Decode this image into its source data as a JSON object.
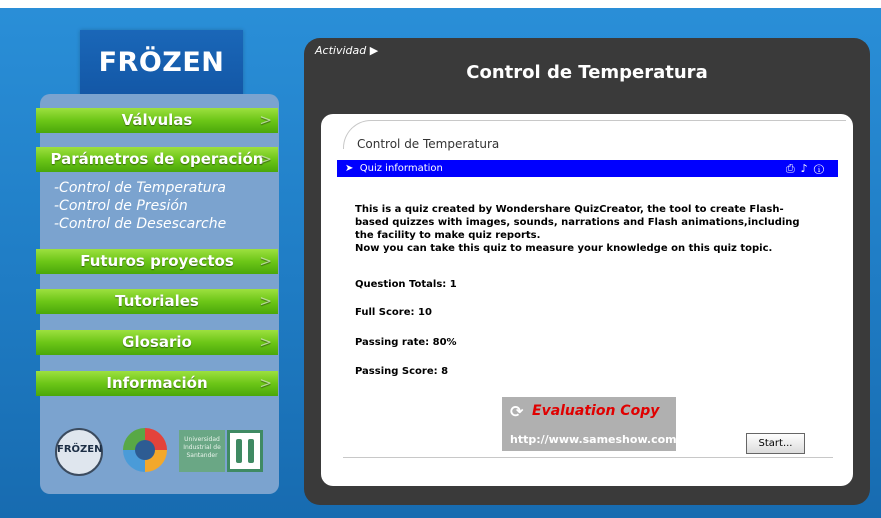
{
  "logo": {
    "text": "FRÖZEN"
  },
  "menu": {
    "items": [
      {
        "label": "Válvulas"
      },
      {
        "label": "Parámetros de operación"
      },
      {
        "label": "Futuros proyectos"
      },
      {
        "label": "Tutoriales"
      },
      {
        "label": "Glosario"
      },
      {
        "label": "Información"
      }
    ],
    "submenu": [
      {
        "label": "-Control de Temperatura"
      },
      {
        "label": "-Control de Presión"
      },
      {
        "label": "-Control de Desescarche"
      }
    ]
  },
  "header": {
    "activity": "Actividad ▶",
    "title": "Control de Temperatura"
  },
  "quiz": {
    "panel_title": "Control de Temperatura",
    "bar_label": "Quiz information",
    "bar_icons": [
      "print-icon",
      "speaker-icon",
      "info-icon"
    ],
    "intro": "This is a quiz created by Wondershare QuizCreator, the tool to create Flash-based quizzes with images, sounds, narrations and Flash animations,including the facility to make quiz reports.",
    "intro2": "Now you can take this quiz to measure your knowledge on this quiz topic.",
    "question_totals": "Question Totals: 1",
    "full_score": "Full Score: 10",
    "passing_rate": "Passing rate: 80%",
    "passing_score": "Passing Score: 8",
    "start_label": "Start..."
  },
  "evaluation": {
    "title": "Evaluation Copy",
    "url": "http://www.sameshow.com"
  },
  "footer_badges": {
    "frozen_badge": "FRÖZEN",
    "university": "Universidad Industrial de Santander"
  },
  "colors": {
    "bar_blue": "#0000ff",
    "menu_green": "#6cc617",
    "panel_dark": "#3a3a3a"
  }
}
